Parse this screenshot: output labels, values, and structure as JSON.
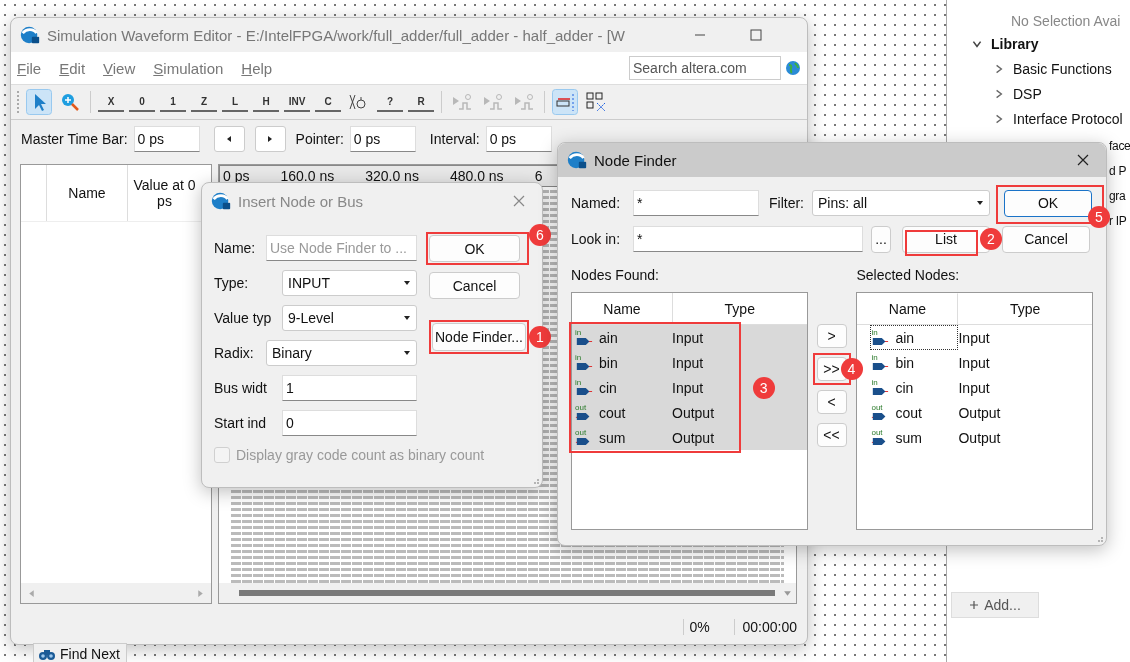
{
  "main_window": {
    "title": "Simulation Waveform Editor - E:/IntelFPGA/work/full_adder/full_adder - half_adder - [W",
    "menu": [
      "File",
      "Edit",
      "View",
      "Simulation",
      "Help"
    ],
    "search": {
      "placeholder": "Search altera.com"
    },
    "toolbar": [
      {
        "kind": "pointer",
        "selected": true
      },
      {
        "kind": "zoom",
        "selected": false
      },
      {
        "kind": "separator"
      },
      {
        "kind": "glyph",
        "glyph": "X",
        "selected": false
      },
      {
        "kind": "glyph",
        "glyph": "0",
        "selected": false
      },
      {
        "kind": "glyph",
        "glyph": "1",
        "selected": false
      },
      {
        "kind": "glyph",
        "glyph": "Z",
        "selected": false
      },
      {
        "kind": "glyph",
        "glyph": "L",
        "selected": false
      },
      {
        "kind": "glyph",
        "glyph": "H",
        "selected": false
      },
      {
        "kind": "glyph",
        "glyph": "INV",
        "selected": false
      },
      {
        "kind": "glyph",
        "glyph": "C",
        "selected": false
      },
      {
        "kind": "count",
        "selected": false
      },
      {
        "kind": "glyph",
        "glyph": "?",
        "selected": false
      },
      {
        "kind": "glyph",
        "glyph": "R",
        "selected": false
      },
      {
        "kind": "separator"
      },
      {
        "kind": "assign",
        "selected": false
      },
      {
        "kind": "assign",
        "selected": false
      },
      {
        "kind": "assign",
        "selected": false
      },
      {
        "kind": "separator"
      },
      {
        "kind": "snap",
        "selected": true
      },
      {
        "kind": "grid",
        "selected": false
      }
    ],
    "time_bar": {
      "master_label": "Master Time Bar:",
      "master_value": "0 ps",
      "pointer_label": "Pointer:",
      "pointer_value": "0 ps",
      "interval_label": "Interval:",
      "interval_value": "0 ps"
    },
    "name_table": {
      "columns": [
        "Name",
        "Value at 0 ps"
      ]
    },
    "waveform": {
      "time_labels": [
        "0 ps",
        "160.0 ns",
        "320.0 ns",
        "480.0 ns",
        "6"
      ]
    },
    "status_bar": {
      "progress": "0%",
      "elapsed": "00:00:00"
    }
  },
  "insert_dialog": {
    "title": "Insert Node or Bus",
    "fields": [
      {
        "label": "Name:",
        "kind": "text",
        "placeholder": "Use Node Finder to ..."
      },
      {
        "label": "Type:",
        "kind": "select",
        "value": "INPUT"
      },
      {
        "label": "Value typ",
        "kind": "select",
        "value": "9-Level"
      },
      {
        "label": "Radix:",
        "kind": "select",
        "value": "Binary"
      },
      {
        "label": "Bus widt",
        "kind": "text",
        "value": "1"
      },
      {
        "label": "Start ind",
        "kind": "text",
        "value": "0"
      }
    ],
    "checkbox": {
      "label": "Display gray code count as binary count",
      "checked": false,
      "disabled": true
    },
    "buttons": [
      {
        "label": "OK",
        "callout": "6"
      },
      {
        "label": "Cancel"
      },
      {
        "label": "Node Finder...",
        "callout": "1"
      }
    ]
  },
  "node_finder": {
    "title": "Node Finder",
    "named": {
      "label": "Named:",
      "value": "*"
    },
    "filter": {
      "label": "Filter:",
      "value": "Pins: all"
    },
    "look_in": {
      "label": "Look in:",
      "value": "*"
    },
    "browse": "...",
    "buttons": [
      {
        "label": "OK",
        "default": true,
        "callout": "5"
      },
      {
        "label": "List",
        "default": false,
        "callout": "2"
      },
      {
        "label": "Cancel",
        "default": false
      }
    ],
    "found": {
      "label": "Nodes Found:",
      "columns": [
        "Name",
        "Type"
      ],
      "callout": "3",
      "rows": [
        {
          "name": "ain",
          "type": "Input",
          "direction": "in",
          "selected": true
        },
        {
          "name": "bin",
          "type": "Input",
          "direction": "in",
          "selected": true
        },
        {
          "name": "cin",
          "type": "Input",
          "direction": "in",
          "selected": true
        },
        {
          "name": "cout",
          "type": "Output",
          "direction": "out",
          "selected": true
        },
        {
          "name": "sum",
          "type": "Output",
          "direction": "out",
          "selected": true
        }
      ]
    },
    "transfer_buttons": [
      {
        "label": ">"
      },
      {
        "label": ">>",
        "callout": "4"
      },
      {
        "label": "<"
      },
      {
        "label": "<<"
      }
    ],
    "selected_nodes": {
      "label": "Selected Nodes:",
      "columns": [
        "Name",
        "Type"
      ],
      "rows": [
        {
          "name": "ain",
          "type": "Input",
          "direction": "in",
          "focused": true
        },
        {
          "name": "bin",
          "type": "Input",
          "direction": "in",
          "focused": false
        },
        {
          "name": "cin",
          "type": "Input",
          "direction": "in",
          "focused": false
        },
        {
          "name": "cout",
          "type": "Output",
          "direction": "out",
          "focused": false
        },
        {
          "name": "sum",
          "type": "Output",
          "direction": "out",
          "focused": false
        }
      ]
    }
  },
  "library_panel": {
    "status": "No Selection Avai",
    "tree": [
      {
        "label": "Library",
        "expanded": true,
        "children": [
          {
            "label": "Basic Functions",
            "expanded": false
          },
          {
            "label": "DSP",
            "expanded": false
          },
          {
            "label": "Interface Protocol",
            "expanded": false
          }
        ]
      }
    ],
    "hidden_fragments": [
      "face",
      "d P",
      "gra",
      "r IP"
    ],
    "add_button": "Add..."
  },
  "find_next": {
    "label": "Find Next"
  }
}
